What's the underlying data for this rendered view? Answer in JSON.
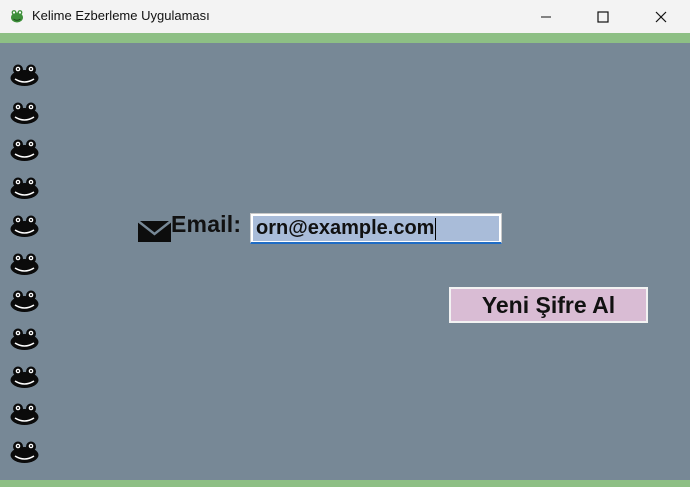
{
  "window": {
    "title": "Kelime Ezberleme Uygulaması",
    "app_icon": "frog-icon",
    "controls": [
      "minimize-icon",
      "maximize-icon",
      "close-icon"
    ]
  },
  "sidebar": {
    "decoration_icon": "frog-icon",
    "count": 11
  },
  "form": {
    "email_icon": "envelope-icon",
    "email_label": "Email:",
    "email_value": "orn@example.com",
    "submit_label": "Yeni Şifre Al"
  },
  "colors": {
    "background": "#778896",
    "accent_bar": "#8dbf84",
    "button_bg": "#d9bcd4",
    "selection": "#a9bcd9"
  }
}
